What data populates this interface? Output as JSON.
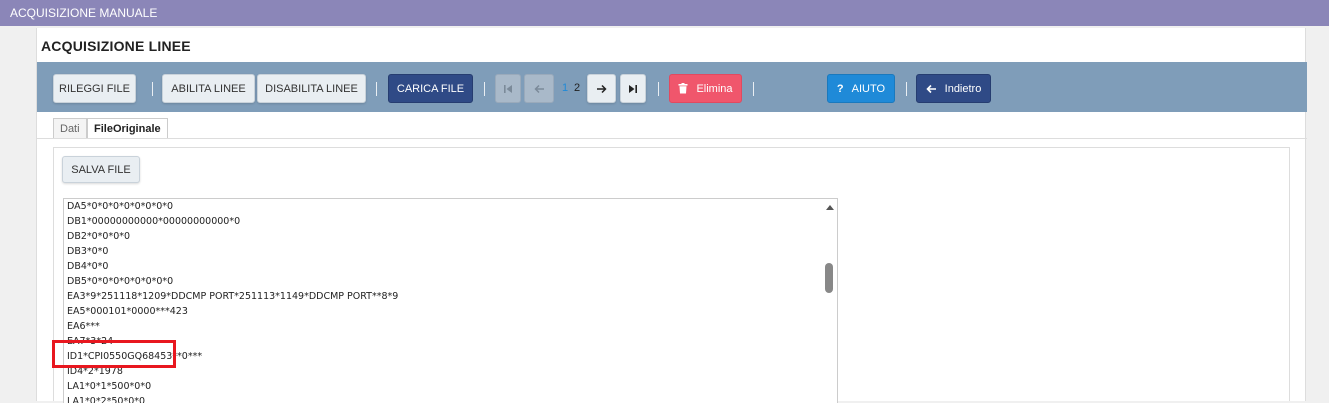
{
  "window": {
    "title": "ACQUISIZIONE MANUALE"
  },
  "page": {
    "title": "ACQUISIZIONE LINEE"
  },
  "toolbar": {
    "rileggi_label": "RILEGGI FILE",
    "abilita_label": "ABILITA LINEE",
    "disabilita_label": "DISABILITA LINEE",
    "carica_label": "CARICA FILE",
    "pages": [
      "1",
      "2"
    ],
    "current_page": "1",
    "elimina_label": "Elimina",
    "aiuto_label": "AIUTO",
    "aiuto_icon": "?",
    "indietro_label": "Indietro"
  },
  "tabs": [
    {
      "label": "Dati",
      "active": false
    },
    {
      "label": "FileOriginale",
      "active": true
    }
  ],
  "file": {
    "save_label": "SALVA FILE",
    "lines": [
      "DA5*0*0*0*0*0*0*0*0",
      "DB1*00000000000*00000000000*0",
      "DB2*0*0*0*0",
      "DB3*0*0",
      "DB4*0*0",
      "DB5*0*0*0*0*0*0*0*0",
      "EA3*9*251118*1209*DDCMP PORT*251113*1149*DDCMP PORT**8*9",
      "EA5*000101*0000***423",
      "EA6***",
      "EA7*3*24",
      "ID1*CPI0550GQ68453**0***",
      "ID4*2*1978",
      "LA1*0*1*500*0*0",
      "LA1*0*2*50*0*0"
    ]
  },
  "colors": {
    "topbar": "#8b86b8",
    "toolbar": "#7f9db9",
    "navy_button": "#2f4a86",
    "delete_button": "#f0566c",
    "help_button": "#1f8ad8",
    "highlight": "#e8171f"
  }
}
